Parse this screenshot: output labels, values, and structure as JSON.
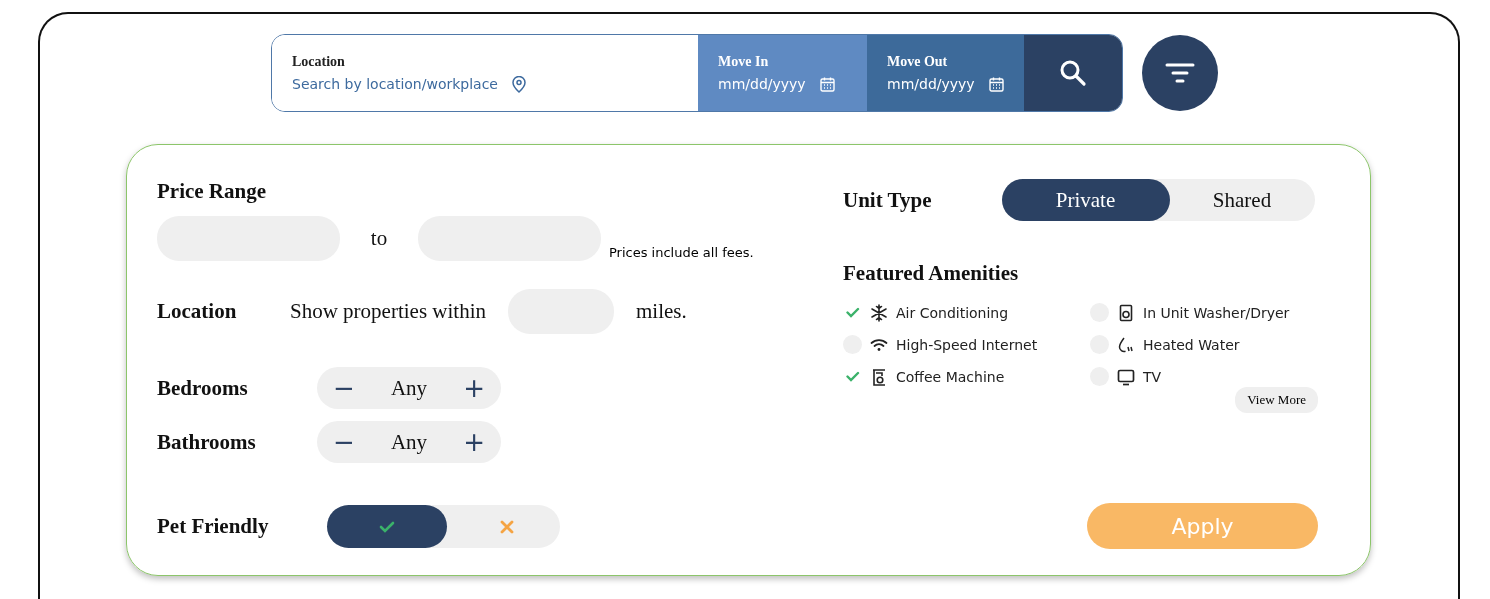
{
  "search_bar": {
    "location": {
      "label": "Location",
      "placeholder": "Search by location/workplace"
    },
    "move_in": {
      "label": "Move In",
      "placeholder": "mm/dd/yyyy"
    },
    "move_out": {
      "label": "Move Out",
      "placeholder": "mm/dd/yyyy"
    }
  },
  "filters": {
    "price_range": {
      "label": "Price Range",
      "separator": "to",
      "note": "Prices include all fees."
    },
    "location": {
      "label": "Location",
      "prefix": "Show properties within",
      "suffix": "miles."
    },
    "bedrooms": {
      "label": "Bedrooms",
      "minus": "−",
      "value": "Any",
      "plus": "+"
    },
    "bathrooms": {
      "label": "Bathrooms",
      "minus": "−",
      "value": "Any",
      "plus": "+"
    },
    "pet_friendly": {
      "label": "Pet Friendly",
      "options": [
        {
          "kind": "yes",
          "selected": true
        },
        {
          "kind": "no",
          "selected": false
        }
      ]
    },
    "unit_type": {
      "label": "Unit Type",
      "options": [
        {
          "label": "Private",
          "selected": true
        },
        {
          "label": "Shared",
          "selected": false
        }
      ]
    },
    "amenities": {
      "title": "Featured Amenities",
      "items": [
        {
          "label": "Air Conditioning",
          "checked": true
        },
        {
          "label": "High-Speed Internet",
          "checked": false
        },
        {
          "label": "Coffee Machine",
          "checked": true
        },
        {
          "label": "In Unit Washer/Dryer",
          "checked": false
        },
        {
          "label": "Heated Water",
          "checked": false
        },
        {
          "label": "TV",
          "checked": false
        }
      ],
      "view_more": "View More"
    },
    "apply": "Apply"
  }
}
